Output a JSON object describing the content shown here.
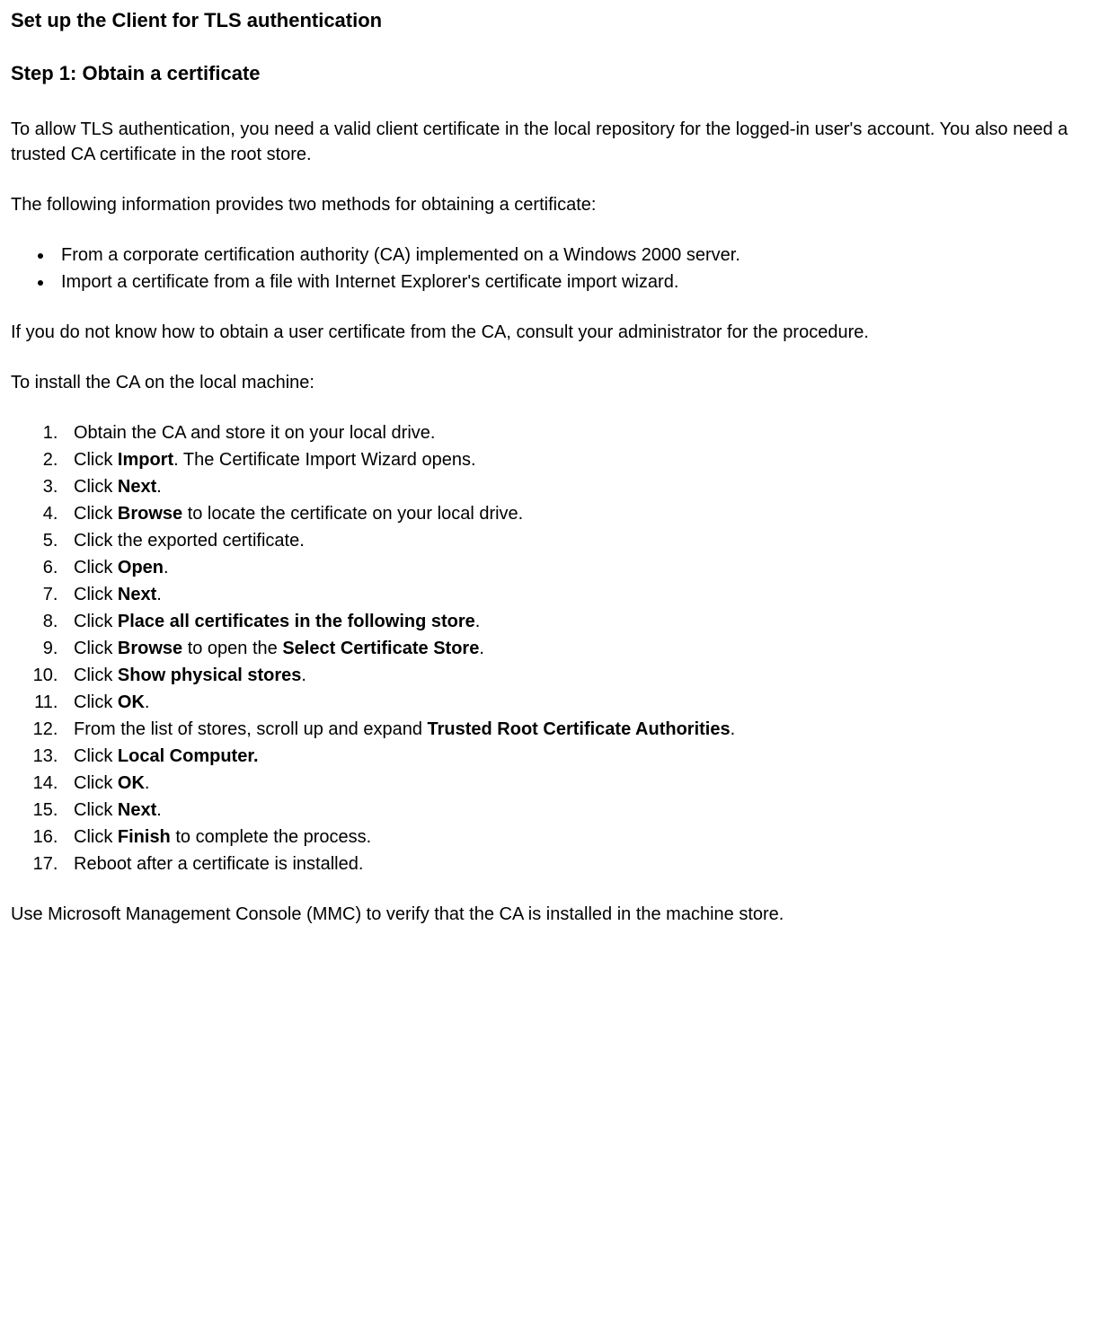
{
  "title": "Set up the Client for TLS authentication",
  "step_heading": "Step 1: Obtain a certificate",
  "intro_p1": "To allow TLS authentication, you need a valid client certificate in the local repository for the logged-in user's account.  You also need a trusted CA certificate in the root store.",
  "intro_p2": "The following information provides two methods for obtaining a certificate:",
  "bullets": [
    "From a corporate certification authority (CA) implemented on a Windows 2000 server.",
    "Import a certificate from a file with Internet Explorer's certificate import wizard."
  ],
  "p_after_bullets": "If you do not know how to obtain a user certificate from the CA, consult your administrator for the procedure.",
  "p_install_intro": "To install the CA on the local machine:",
  "steps": {
    "s1": "Obtain the CA and store it on your local drive.",
    "s2_a": "Click ",
    "s2_b": "Import",
    "s2_c": ". The Certificate Import Wizard opens.",
    "s3_a": "Click ",
    "s3_b": "Next",
    "s3_c": ".",
    "s4_a": "Click ",
    "s4_b": "Browse",
    "s4_c": " to locate the certificate on your local drive.",
    "s5": "Click the exported certificate.",
    "s6_a": "Click ",
    "s6_b": "Open",
    "s6_c": ".",
    "s7_a": "Click ",
    "s7_b": "Next",
    "s7_c": ".",
    "s8_a": "Click ",
    "s8_b": "Place all certificates in the following store",
    "s8_c": ".",
    "s9_a": "Click ",
    "s9_b": "Browse",
    "s9_c": " to open the ",
    "s9_d": "Select Certificate Store",
    "s9_e": ".",
    "s10_a": "Click ",
    "s10_b": "Show physical stores",
    "s10_c": ".",
    "s11_a": "Click ",
    "s11_b": "OK",
    "s11_c": ".",
    "s12_a": "From the list of stores, scroll up and expand ",
    "s12_b": "Trusted Root Certificate Authorities",
    "s12_c": ".",
    "s13_a": "Click ",
    "s13_b": "Local Computer.",
    "s14_a": "Click ",
    "s14_b": "OK",
    "s14_c": ".",
    "s15_a": "Click ",
    "s15_b": "Next",
    "s15_c": ".",
    "s16_a": "Click ",
    "s16_b": "Finish",
    "s16_c": " to complete the process.",
    "s17": "Reboot after a certificate is installed."
  },
  "closing": "Use Microsoft Management Console (MMC) to verify that the CA is installed in the machine store."
}
